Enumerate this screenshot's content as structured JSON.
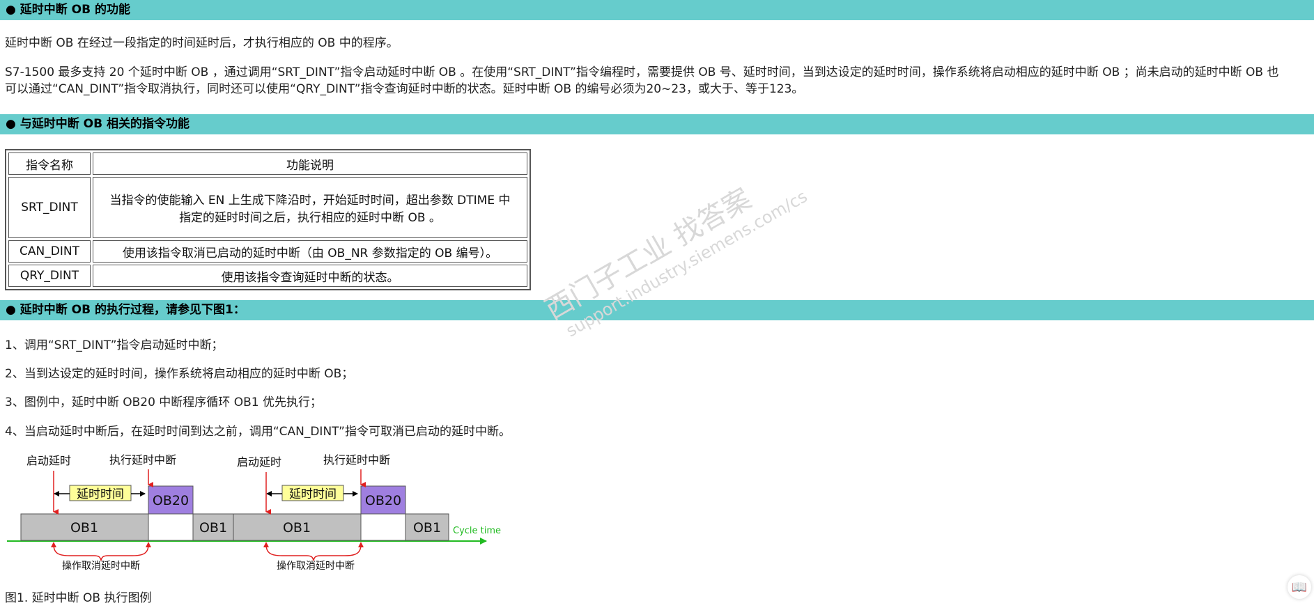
{
  "sections": {
    "function_title": "● 延时中断 OB 的功能",
    "related_title": "● 与延时中断 OB 相关的指令功能",
    "process_title": "● 延时中断 OB 的执行过程，请参见下图1："
  },
  "intro": {
    "line1": "延时中断 OB 在经过一段指定的时间延时后，才执行相应的 OB 中的程序。",
    "line2a": "S7-1500 最多支持 20 个延时中断 OB ，通过调用“SRT_DINT”指令启动延时中断 OB 。在使用“SRT_DINT”指令编程时，需要提供 OB 号、延时时间，当到达设定的延时时间，操作系统将启动相应的延时中断 OB ；尚未启动的延时中断 OB 也",
    "line2b": "可以通过“CAN_DINT”指令取消执行，同时还可以使用“QRY_DINT”指令查询延时中断的状态。延时中断 OB 的编号必须为20~23，或大于、等于123。"
  },
  "table": {
    "headers": [
      "指令名称",
      "功能说明"
    ],
    "rows": [
      {
        "name": "SRT_DINT",
        "desc1": "当指令的使能输入 EN 上生成下降沿时，开始延时时间，超出参数 DTIME 中",
        "desc2": "指定的延时时间之后，执行相应的延时中断 OB 。"
      },
      {
        "name": "CAN_DINT",
        "desc1": "使用该指令取消已启动的延时中断（由 OB_NR 参数指定的 OB 编号）。",
        "desc2": ""
      },
      {
        "name": "QRY_DINT",
        "desc1": "使用该指令查询延时中断的状态。",
        "desc2": ""
      }
    ]
  },
  "steps": [
    "1、调用“SRT_DINT”指令启动延时中断；",
    "2、当到达设定的延时时间，操作系统将启动相应的延时中断 OB；",
    "3、图例中，延时中断 OB20 中断程序循环 OB1 优先执行；",
    "4、当启动延时中断后，在延时时间到达之前，调用“CAN_DINT”指令可取消已启动的延时中断。"
  ],
  "diagram": {
    "start_delay": "启动延时",
    "exec_interrupt": "执行延时中断",
    "delay_time": "延时时间",
    "ob20": "OB20",
    "ob1": "OB1",
    "cycle_time": "Cycle time",
    "cancel": "操作取消延时中断"
  },
  "watermark": {
    "line1": "西门子工业  找答案",
    "line2": "support.industry.siemens.com/cs"
  },
  "figure_caption": "图1. 延时中断 OB 执行图例",
  "colors": {
    "header_bg": "#66cccc",
    "ob20_fill": "#9f7fe0",
    "delay_fill": "#ffff99",
    "ob1_fill": "#c0c0c0",
    "arrow_red": "#e02020",
    "axis_green": "#22bb22"
  },
  "corner_icon": "book-icon"
}
